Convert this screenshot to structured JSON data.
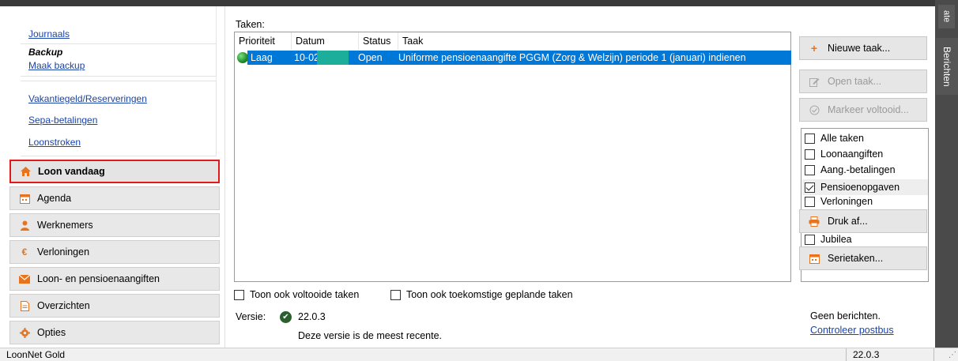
{
  "app": {
    "status_title": "LoonNet Gold",
    "status_version": "22.0.3"
  },
  "side_tabs": {
    "top": "ate",
    "berichten": "Berichten"
  },
  "sidebar": {
    "links": {
      "journaals": "Journaals",
      "backup_title": "Backup",
      "maak_backup": "Maak backup",
      "vakantiegeld": "Vakantiegeld/Reserveringen",
      "sepa": "Sepa-betalingen",
      "loonstroken": "Loonstroken"
    },
    "nav": [
      {
        "label": "Loon vandaag",
        "underline_char": "v",
        "icon": "home-icon",
        "active": true
      },
      {
        "label": "Agenda",
        "underline_char": "A",
        "icon": "calendar-icon",
        "active": false
      },
      {
        "label": "Werknemers",
        "underline_char": "W",
        "icon": "person-icon",
        "active": false
      },
      {
        "label": "Verloningen",
        "underline_char": "",
        "icon": "euro-icon",
        "active": false
      },
      {
        "label": "Loon- en pensioenaangiften",
        "underline_char": "L",
        "icon": "envelope-icon",
        "active": false
      },
      {
        "label": "Overzichten",
        "underline_char": "O",
        "icon": "document-icon",
        "active": false
      },
      {
        "label": "Opties",
        "underline_char": "O",
        "icon": "gear-icon",
        "active": false
      }
    ]
  },
  "main": {
    "taken_label": "Taken:",
    "columns": [
      "Prioriteit",
      "Datum",
      "Status",
      "Taak"
    ],
    "rows": [
      {
        "prioriteit": "Laag",
        "datum": "10-02",
        "status": "Open",
        "taak": "Uniforme pensioenaangifte PGGM (Zorg & Welzijn) periode 1 (januari) indienen"
      }
    ],
    "show_completed": "Toon ook voltooide taken",
    "show_future": "Toon ook toekomstige geplande taken",
    "versie_label": "Versie:",
    "versie_value": "22.0.3",
    "versie_msg": "Deze versie is de meest recente."
  },
  "buttons": {
    "nieuwe_taak": "Nieuwe taak...",
    "open_taak": "Open taak...",
    "markeer": "Markeer voltooid...",
    "druk_af": "Druk af...",
    "serietaken": "Serietaken..."
  },
  "filters": [
    {
      "label": "Alle taken",
      "checked": false
    },
    {
      "label": "Loonaangiften",
      "checked": false
    },
    {
      "label": "Aang.-betalingen",
      "checked": false
    },
    {
      "label": "Pensioenopgaven",
      "checked": true
    },
    {
      "label": "Verloningen",
      "checked": false
    },
    {
      "label": "Jubilea",
      "checked": false
    }
  ],
  "messages": {
    "geen": "Geen berichten.",
    "controleer": "Controleer postbus"
  }
}
